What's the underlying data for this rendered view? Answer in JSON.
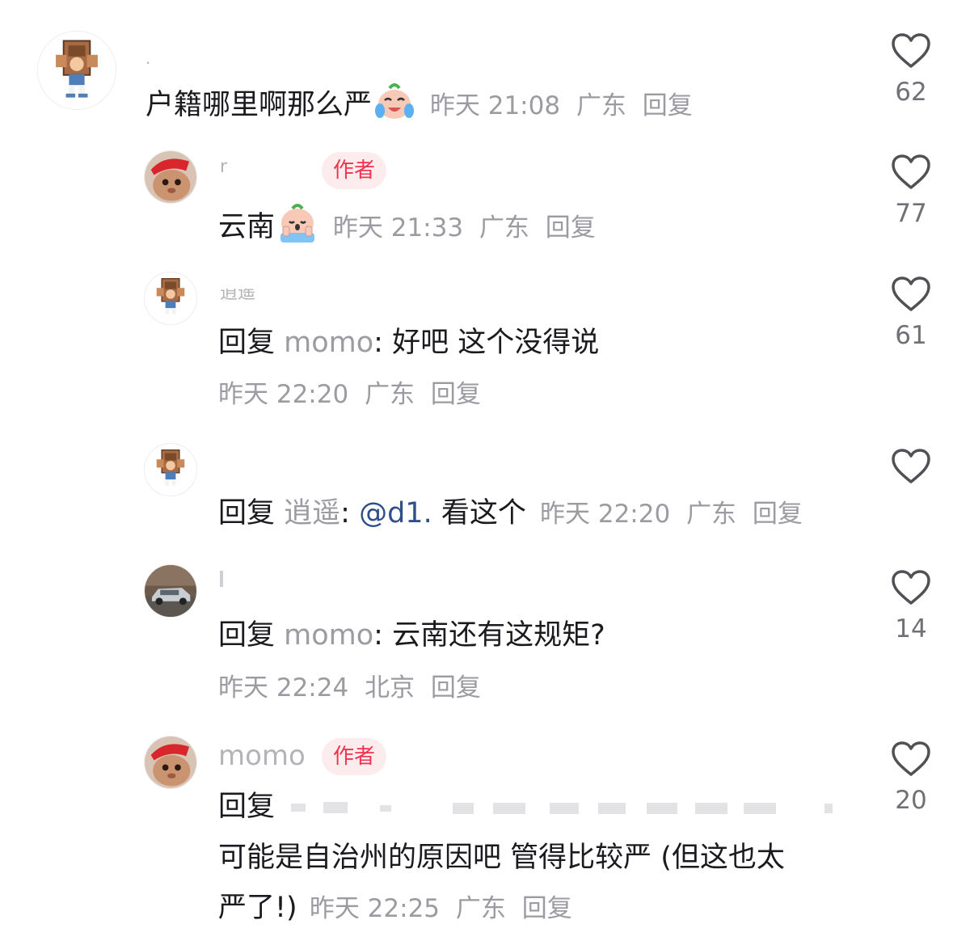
{
  "comments": [
    {
      "id": "c1",
      "author": ".",
      "content": "户籍哪里啊那么严",
      "emoji": "crying-laugh-emoji",
      "time": "昨天 21:08",
      "location": "广东",
      "reply_label": "回复",
      "likes": "62"
    },
    {
      "id": "c2",
      "author": "r",
      "author_tag": "作者",
      "content": "云南",
      "emoji": "crying-hands-emoji",
      "time": "昨天 21:33",
      "location": "广东",
      "reply_label": "回复",
      "likes": "77"
    },
    {
      "id": "c3",
      "author": "逍遥",
      "reply_prefix": "回复",
      "reply_to": "momo",
      "content": ": 好吧 这个没得说",
      "time": "昨天 22:20",
      "location": "广东",
      "reply_label": "回复",
      "likes": "61"
    },
    {
      "id": "c4",
      "reply_prefix": "回复",
      "reply_to": "逍遥",
      "content_sep": ": ",
      "mention": "@d1.",
      "content": " 看这个",
      "time": "昨天 22:20",
      "location": "广东",
      "reply_label": "回复",
      "likes": ""
    },
    {
      "id": "c5",
      "reply_prefix": "回复",
      "reply_to": "momo",
      "content": ": 云南还有这规矩?",
      "time": "昨天 22:24",
      "location": "北京",
      "reply_label": "回复",
      "likes": "14"
    },
    {
      "id": "c6",
      "author": "momo",
      "author_tag": "作者",
      "reply_prefix": "回复",
      "content_line2": "可能是自治州的原因吧 管得比较严 (但这也太",
      "content_line3": "严了!)",
      "time": "昨天 22:25",
      "location": "广东",
      "reply_label": "回复",
      "likes": "20"
    }
  ],
  "colors": {
    "tag_bg": "#fdecee",
    "tag_text": "#f0334f",
    "meta": "#9b9ba1",
    "mention": "#2f4f8a"
  },
  "icons": [
    "heart-outline-icon",
    "avatar-cartoon-box",
    "avatar-cat-red-hat",
    "avatar-car-photo"
  ]
}
